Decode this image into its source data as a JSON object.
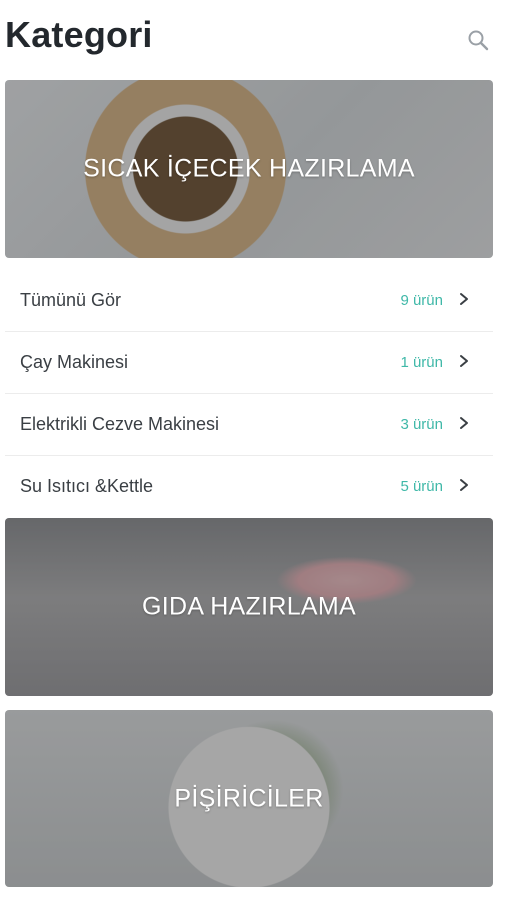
{
  "header": {
    "title": "Kategori",
    "search_icon": "search-icon"
  },
  "banners": [
    {
      "label": "SICAK İÇECEK HAZIRLAMA"
    },
    {
      "label": "GIDA HAZIRLAMA"
    },
    {
      "label": "PİŞİRİCİLER"
    }
  ],
  "subcategories": [
    {
      "name": "Tümünü Gör",
      "count": "9 ürün"
    },
    {
      "name": "Çay Makinesi",
      "count": "1 ürün"
    },
    {
      "name": "Elektrikli Cezve Makinesi",
      "count": "3 ürün"
    },
    {
      "name": "Su Isıtıcı &Kettle",
      "count": "5 ürün"
    }
  ],
  "colors": {
    "accent": "#3fb8a8",
    "title": "#23282d",
    "text": "#3a3f44"
  }
}
